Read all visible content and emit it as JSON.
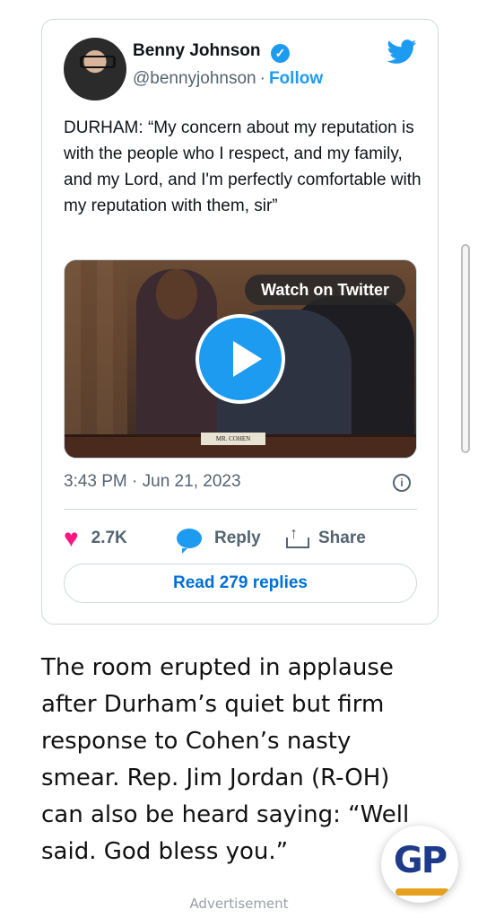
{
  "tweet": {
    "author_name": "Benny Johnson",
    "handle": "@bennyjohnson",
    "separator": "·",
    "follow_label": "Follow",
    "verified_symbol": "✓",
    "text": "DURHAM: “My concern about my reputation is with the people who I respect, and my family, and my Lord, and I'm perfectly comfortable with my reputation with them, sir”",
    "media": {
      "watch_label": "Watch on Twitter",
      "nameplate": "MR. COHEN"
    },
    "timestamp": "3:43 PM · Jun 21, 2023",
    "info_symbol": "i",
    "actions": {
      "likes": "2.7K",
      "reply_label": "Reply",
      "share_label": "Share"
    },
    "read_replies_label": "Read 279 replies"
  },
  "article": {
    "paragraph": "The room erupted in applause after Durham’s quiet but firm response to Cohen’s nasty smear. Rep. Jim Jordan (R-OH) can also be heard saying: “Well said. God bless you.”",
    "advertisement_label": "Advertisement"
  },
  "badge": {
    "text": "GP"
  },
  "icons": {
    "twitter": "twitter-bird-icon",
    "verified": "verified-badge-icon",
    "heart": "heart-icon",
    "reply": "reply-bubble-icon",
    "share": "share-icon",
    "info": "info-icon",
    "play": "play-icon"
  },
  "colors": {
    "twitter_blue": "#1d9bf0",
    "like_pink": "#f91880",
    "link_blue": "#006fd6",
    "secondary_text": "#536471"
  }
}
